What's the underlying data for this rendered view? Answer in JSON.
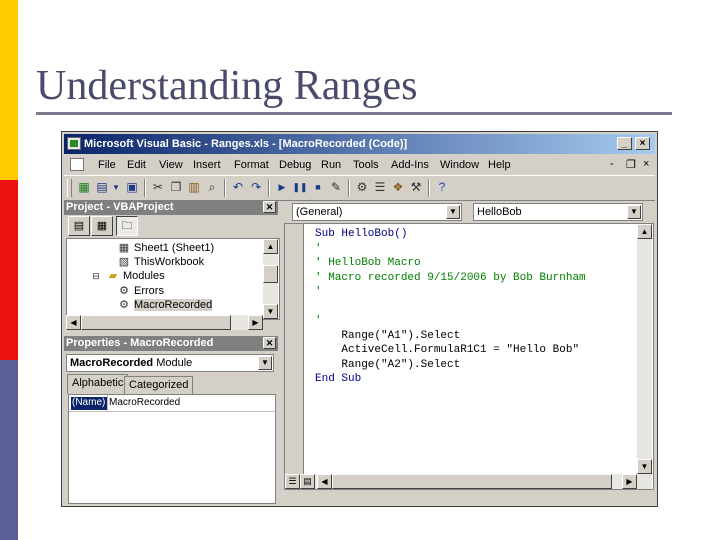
{
  "slide": {
    "title": "Understanding Ranges",
    "colors": {
      "yellow": "#ffcc00",
      "red": "#ee1111",
      "blue": "#5b5f95"
    }
  },
  "window": {
    "title": "Microsoft Visual Basic - Ranges.xls - [MacroRecorded (Code)]",
    "controls": {
      "minimize": "_",
      "restore": "❐",
      "close": "×"
    },
    "mdi_controls": {
      "minimize": "-",
      "restore": "❐",
      "close": "×"
    }
  },
  "menubar": [
    "File",
    "Edit",
    "View",
    "Insert",
    "Format",
    "Debug",
    "Run",
    "Tools",
    "Add-Ins",
    "Window",
    "Help"
  ],
  "toolbar": [
    "excel-icon",
    "insert-module-icon",
    "save-icon",
    "cut-icon",
    "copy-icon",
    "paste-icon",
    "find-icon",
    "undo-icon",
    "redo-icon",
    "run-icon",
    "break-icon",
    "reset-icon",
    "design-mode-icon",
    "project-explorer-icon",
    "properties-icon",
    "object-browser-icon",
    "toolbox-icon",
    "help-icon"
  ],
  "project": {
    "title": "Project - VBAProject",
    "tree": [
      {
        "label": "Sheet1 (Sheet1)",
        "icon": "sheet-icon"
      },
      {
        "label": "ThisWorkbook",
        "icon": "workbook-icon"
      },
      {
        "label": "Modules",
        "icon": "folder-icon"
      },
      {
        "label": "Errors",
        "icon": "module-icon"
      },
      {
        "label": "MacroRecorded",
        "icon": "module-icon",
        "selected": true
      }
    ]
  },
  "properties": {
    "title": "Properties - MacroRecorded",
    "object_bold": "MacroRecorded",
    "object_type": "Module",
    "tabs": [
      "Alphabetic",
      "Categorized"
    ],
    "rows": [
      {
        "name": "(Name)",
        "value": "MacroRecorded"
      }
    ]
  },
  "code": {
    "object_combo": "(General)",
    "procedure_combo": "HelloBob",
    "lines": [
      {
        "kind": "kw",
        "text": "Sub HelloBob()"
      },
      {
        "kind": "cm",
        "text": "'"
      },
      {
        "kind": "cm",
        "text": "' HelloBob Macro"
      },
      {
        "kind": "cm",
        "text": "' Macro recorded 9/15/2006 by Bob Burnham"
      },
      {
        "kind": "cm",
        "text": "'"
      },
      {
        "kind": "tx",
        "text": ""
      },
      {
        "kind": "cm",
        "text": "'"
      },
      {
        "kind": "tx",
        "text": "    Range(\"A1\").Select"
      },
      {
        "kind": "tx",
        "text": "    ActiveCell.FormulaR1C1 = \"Hello Bob\""
      },
      {
        "kind": "tx",
        "text": "    Range(\"A2\").Select"
      },
      {
        "kind": "kw",
        "text": "End Sub"
      }
    ]
  }
}
